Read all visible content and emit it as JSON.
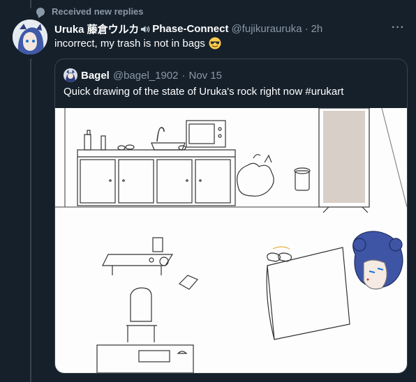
{
  "notice": {
    "label": "Received new replies",
    "icon": "chat-bubble-icon"
  },
  "reply": {
    "name": "Uruka 藤倉ウルカ",
    "name_suffix": "Phase-Connect",
    "handle": "@fujikurauruka",
    "separator": "·",
    "time": "2h",
    "text": "incorrect, my trash is not in bags",
    "emoji": "smiling-face-with-sunglasses",
    "more_icon": "more-options-icon"
  },
  "quote": {
    "name": "Bagel",
    "handle": "@bagel_1902",
    "separator": "·",
    "date": "Nov 15",
    "text": "Quick drawing of the state of Uruka's rock right now #urukart"
  },
  "colors": {
    "background": "#15202b",
    "border": "#38444d",
    "muted": "#8b98a5",
    "text": "#ffffff"
  }
}
